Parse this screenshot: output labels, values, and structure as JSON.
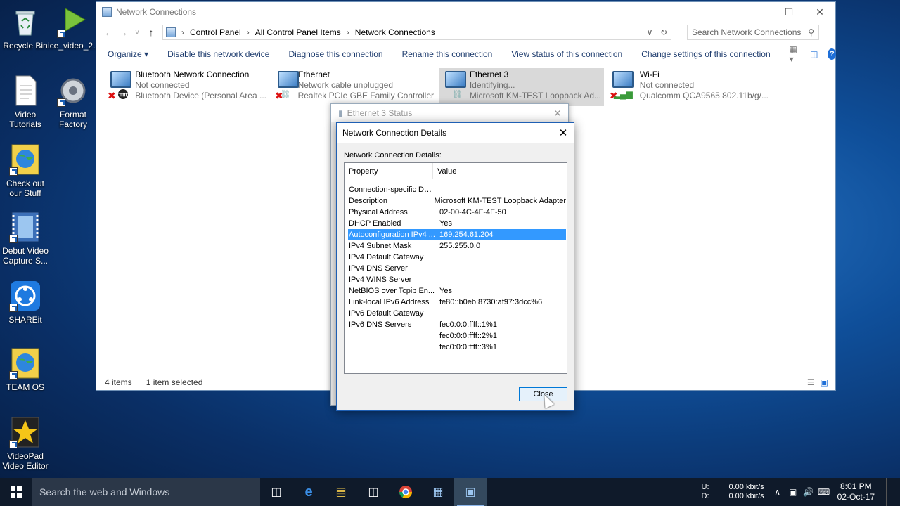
{
  "desktop": {
    "icons": [
      {
        "label": "Recycle Bin",
        "glyph": "recycle-bin-icon"
      },
      {
        "label": "ice_video_2...",
        "glyph": "media-player-icon"
      },
      {
        "label": "Video Tutorials",
        "glyph": "text-file-icon"
      },
      {
        "label": "Format Factory",
        "glyph": "format-factory-icon"
      },
      {
        "label": "Check out our Stuff",
        "glyph": "globe-shortcut-icon"
      },
      {
        "label": "Debut Video Capture S...",
        "glyph": "film-icon"
      },
      {
        "label": "SHAREit",
        "glyph": "shareit-icon"
      },
      {
        "label": "TEAM OS",
        "glyph": "globe-shortcut-icon"
      },
      {
        "label": "VideoPad Video Editor",
        "glyph": "star-icon"
      }
    ]
  },
  "explorer": {
    "title": "Network Connections",
    "breadcrumb": [
      "Control Panel",
      "All Control Panel Items",
      "Network Connections"
    ],
    "search_placeholder": "Search Network Connections",
    "commands": [
      "Organize ▾",
      "Disable this network device",
      "Diagnose this connection",
      "Rename this connection",
      "View status of this connection",
      "Change settings of this connection"
    ],
    "connections": [
      {
        "name": "Bluetooth Network Connection",
        "status": "Not connected",
        "device": "Bluetooth Device (Personal Area ...",
        "state": "disconnected",
        "badge": "bluetooth-icon"
      },
      {
        "name": "Ethernet",
        "status": "Network cable unplugged",
        "device": "Realtek PCIe GBE Family Controller",
        "state": "disconnected",
        "badge": "cable-icon"
      },
      {
        "name": "Ethernet 3",
        "status": "Identifying...",
        "device": "Microsoft KM-TEST Loopback Ad...",
        "state": "selected",
        "badge": "cable-icon"
      },
      {
        "name": "Wi-Fi",
        "status": "Not connected",
        "device": "Qualcomm QCA9565 802.11b/g/...",
        "state": "disconnected",
        "badge": "signal-bars-icon"
      }
    ],
    "status": {
      "items": "4 items",
      "selected": "1 item selected"
    }
  },
  "status_dialog": {
    "title": "Ethernet 3 Status"
  },
  "details_dialog": {
    "title": "Network Connection Details",
    "label": "Network Connection Details:",
    "columns": [
      "Property",
      "Value"
    ],
    "rows": [
      {
        "property": "Connection-specific DN...",
        "value": ""
      },
      {
        "property": "Description",
        "value": "Microsoft KM-TEST Loopback Adapter"
      },
      {
        "property": "Physical Address",
        "value": "02-00-4C-4F-4F-50"
      },
      {
        "property": "DHCP Enabled",
        "value": "Yes"
      },
      {
        "property": "Autoconfiguration IPv4 ...",
        "value": "169.254.61.204",
        "highlight": true
      },
      {
        "property": "IPv4 Subnet Mask",
        "value": "255.255.0.0"
      },
      {
        "property": "IPv4 Default Gateway",
        "value": ""
      },
      {
        "property": "IPv4 DNS Server",
        "value": ""
      },
      {
        "property": "IPv4 WINS Server",
        "value": ""
      },
      {
        "property": "NetBIOS over Tcpip En...",
        "value": "Yes"
      },
      {
        "property": "Link-local IPv6 Address",
        "value": "fe80::b0eb:8730:af97:3dcc%6"
      },
      {
        "property": "IPv6 Default Gateway",
        "value": ""
      },
      {
        "property": "IPv6 DNS Servers",
        "value": "fec0:0:0:ffff::1%1"
      },
      {
        "property": "",
        "value": "fec0:0:0:ffff::2%1"
      },
      {
        "property": "",
        "value": "fec0:0:0:ffff::3%1"
      }
    ],
    "close_label": "Close"
  },
  "taskbar": {
    "search_placeholder": "Search the web and Windows",
    "drives": [
      "U:",
      "D:"
    ],
    "speeds": [
      "0.00 kbit/s",
      "0.00 kbit/s"
    ],
    "time": "8:01 PM",
    "date": "02-Oct-17"
  },
  "colors": {
    "accent": "#0078d7",
    "selection": "#3399ff",
    "taskbar": "#0f1a2a"
  }
}
